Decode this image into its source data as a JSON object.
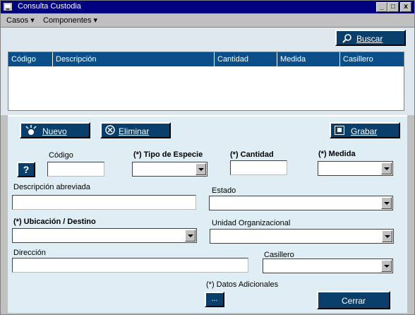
{
  "window": {
    "title": "Consulta Custodia",
    "minimize_glyph": "_",
    "maximize_glyph": "□",
    "close_glyph": "x"
  },
  "menu": {
    "casos": "Casos ▾",
    "componentes": "Componentes ▾"
  },
  "search": {
    "buscar_label": "Buscar"
  },
  "grid": {
    "columns": [
      "Código",
      "Descripción",
      "Cantidad",
      "Medida",
      "Casillero"
    ]
  },
  "toolbar": {
    "nuevo_label": "Nuevo",
    "eliminar_label": "Eliminar",
    "grabar_label": "Grabar"
  },
  "form": {
    "help_label": "?",
    "codigo_label": "Código",
    "tipo_especie_label": "(*) Tipo de Especie",
    "cantidad_label": "(*) Cantidad",
    "medida_label": "(*) Medida",
    "descripcion_label": "Descripción abreviada",
    "estado_label": "Estado",
    "ubicacion_label": "(*) Ubicación / Destino",
    "unidad_label": "Unidad Organizacional",
    "direccion_label": "Dirección",
    "casillero_label": "Casillero",
    "datos_adicionales_label": "(*) Datos Adicionales",
    "dots_label": "...",
    "cerrar_label": "Cerrar"
  },
  "colors": {
    "titlebar": "#000080",
    "button_blue": "#0b3f6b",
    "grid_header": "#0b4f8a",
    "form_bg": "#dfeef4"
  }
}
